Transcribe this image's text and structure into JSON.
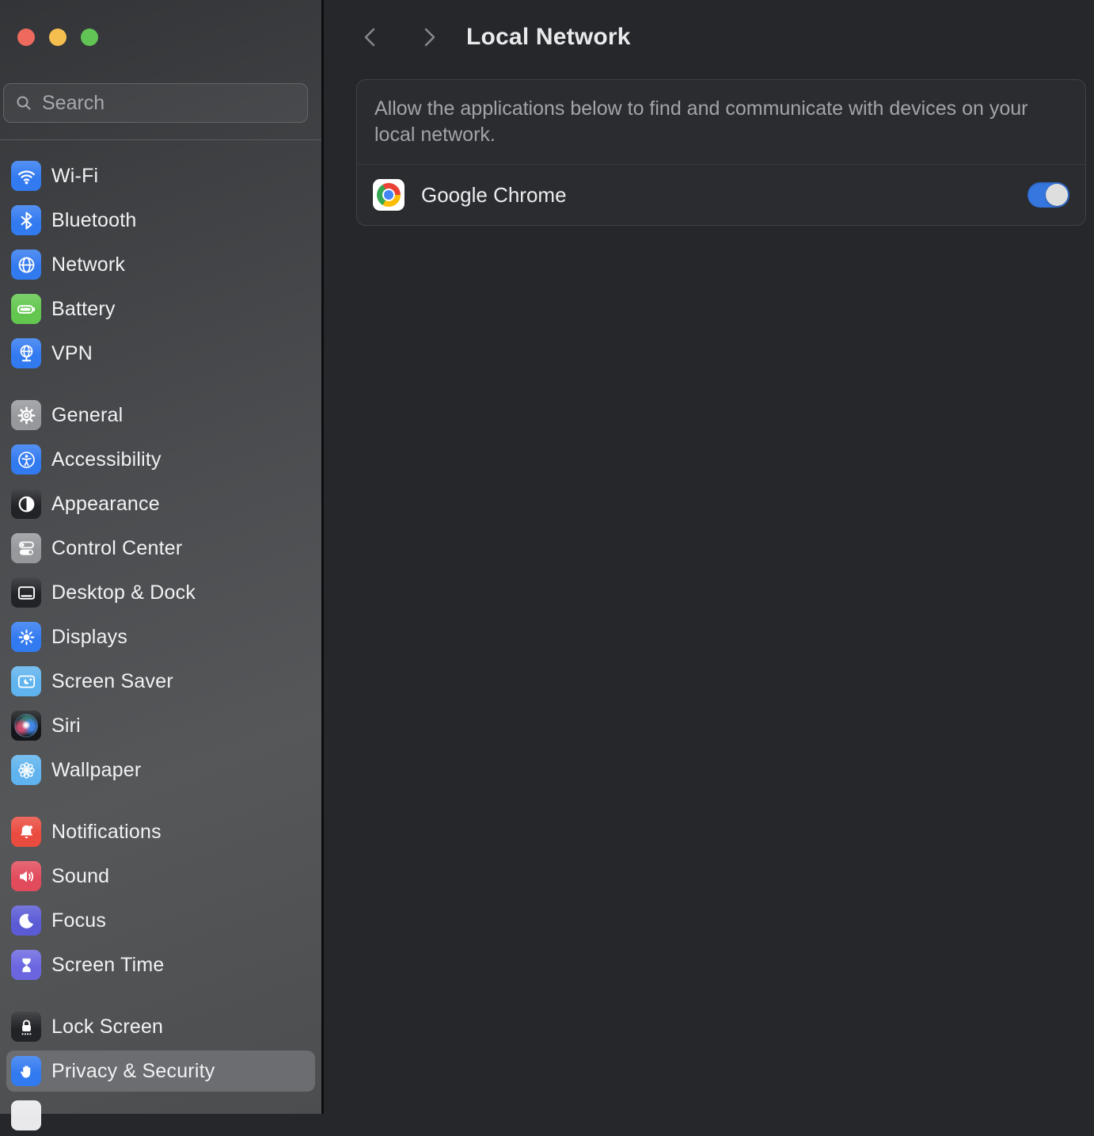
{
  "window": {
    "controls": [
      {
        "name": "close-button"
      },
      {
        "name": "minimize-button"
      },
      {
        "name": "zoom-button"
      }
    ]
  },
  "colors": {
    "traffic": [
      "#EE6A5F",
      "#F5BF4F",
      "#61C455"
    ],
    "toggle_on": "#3576DF",
    "selected_row": "#6B6D71"
  },
  "sidebar": {
    "search": {
      "placeholder": "Search",
      "icon": "search-icon"
    },
    "groups": [
      {
        "items": [
          {
            "label": "Wi-Fi",
            "icon": "wifi-icon",
            "icon_bg": "#327AF0"
          },
          {
            "label": "Bluetooth",
            "icon": "bluetooth-icon",
            "icon_bg": "#327AF0"
          },
          {
            "label": "Network",
            "icon": "globe-icon",
            "icon_bg": "#327AF0"
          },
          {
            "label": "Battery",
            "icon": "battery-icon",
            "icon_bg": "#63C74F"
          },
          {
            "label": "VPN",
            "icon": "vpn-globe-icon",
            "icon_bg": "#327AF0"
          }
        ]
      },
      {
        "items": [
          {
            "label": "General",
            "icon": "gear-icon",
            "icon_bg": "#96989C"
          },
          {
            "label": "Accessibility",
            "icon": "accessibility-icon",
            "icon_bg": "#327AF0"
          },
          {
            "label": "Appearance",
            "icon": "appearance-icon",
            "icon_bg": "#222327"
          },
          {
            "label": "Control Center",
            "icon": "control-center-icon",
            "icon_bg": "#96989C"
          },
          {
            "label": "Desktop & Dock",
            "icon": "desktop-dock-icon",
            "icon_bg": "#222327"
          },
          {
            "label": "Displays",
            "icon": "sun-icon",
            "icon_bg": "#327AF0"
          },
          {
            "label": "Screen Saver",
            "icon": "screen-saver-icon",
            "icon_bg": "#5FB3EE"
          },
          {
            "label": "Siri",
            "icon": "siri-orb-icon",
            "icon_bg": "#141619"
          },
          {
            "label": "Wallpaper",
            "icon": "flower-icon",
            "icon_bg": "#5FB3EE"
          }
        ]
      },
      {
        "items": [
          {
            "label": "Notifications",
            "icon": "bell-icon",
            "icon_bg": "#EA4B3F"
          },
          {
            "label": "Sound",
            "icon": "speaker-icon",
            "icon_bg": "#E14B5C"
          },
          {
            "label": "Focus",
            "icon": "moon-icon",
            "icon_bg": "#5B5BD6"
          },
          {
            "label": "Screen Time",
            "icon": "hourglass-icon",
            "icon_bg": "#6B66E0"
          }
        ]
      },
      {
        "items": [
          {
            "label": "Lock Screen",
            "icon": "lock-icon",
            "icon_bg": "#222327"
          },
          {
            "label": "Privacy & Security",
            "icon": "hand-icon",
            "icon_bg": "#327AF0",
            "selected": true
          },
          {
            "label": "",
            "icon": "partial-app-icon",
            "icon_bg": "#E9E9EB",
            "partial": true
          }
        ]
      }
    ]
  },
  "header": {
    "back_icon": "chevron-left-icon",
    "forward_icon": "chevron-right-icon",
    "title": "Local Network"
  },
  "content": {
    "description": "Allow the applications below to find and communicate with devices on your local network.",
    "apps": [
      {
        "name": "Google Chrome",
        "icon": "chrome-icon",
        "enabled": true
      }
    ]
  }
}
